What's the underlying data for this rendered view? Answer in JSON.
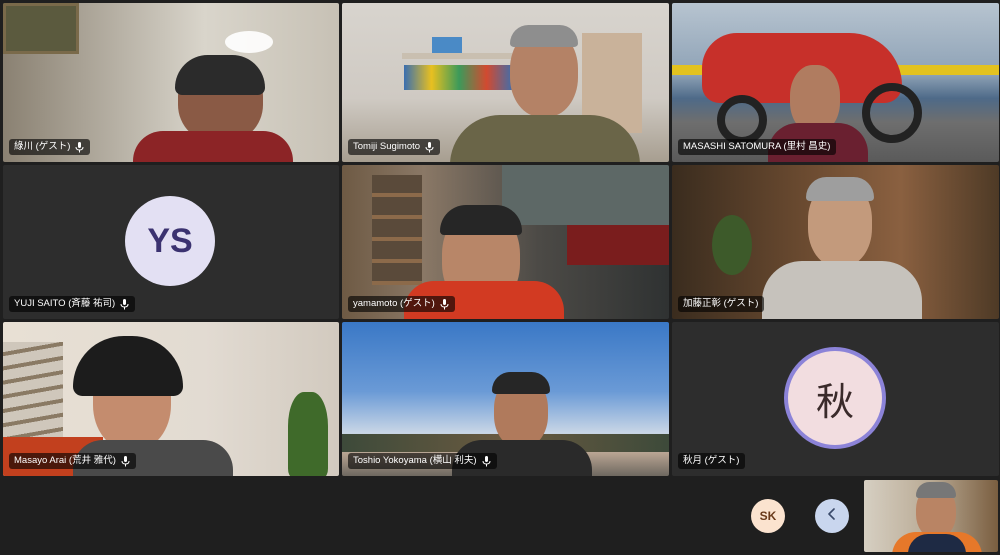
{
  "participants": [
    {
      "name": "綠川 (ゲスト)"
    },
    {
      "name": "Tomiji Sugimoto"
    },
    {
      "name": "MASASHI SATOMURA (里村 昌史)"
    },
    {
      "name": "YUJI SAITO (斉藤 祐司)",
      "initials": "YS"
    },
    {
      "name": "yamamoto (ゲスト)"
    },
    {
      "name": "加藤正彰 (ゲスト)"
    },
    {
      "name": "Masayo Arai (荒井 雅代)"
    },
    {
      "name": "Toshio Yokoyama (横山 利夫)"
    },
    {
      "name": "秋月 (ゲスト)",
      "initials": "秋"
    }
  ],
  "controls": {
    "self_avatar_initials": "SK",
    "collapse_icon": "chevron-left-icon"
  },
  "colors": {
    "background": "#1f1f1f",
    "avatar_ys_bg": "#e3e0f3",
    "avatar_ys_text": "#3b3270",
    "avatar_aki_bg": "#f2dde0",
    "avatar_aki_ring": "#8c83d8",
    "sk_button_bg": "#fbe3cf",
    "chevron_button_bg": "#c9d6ee"
  }
}
